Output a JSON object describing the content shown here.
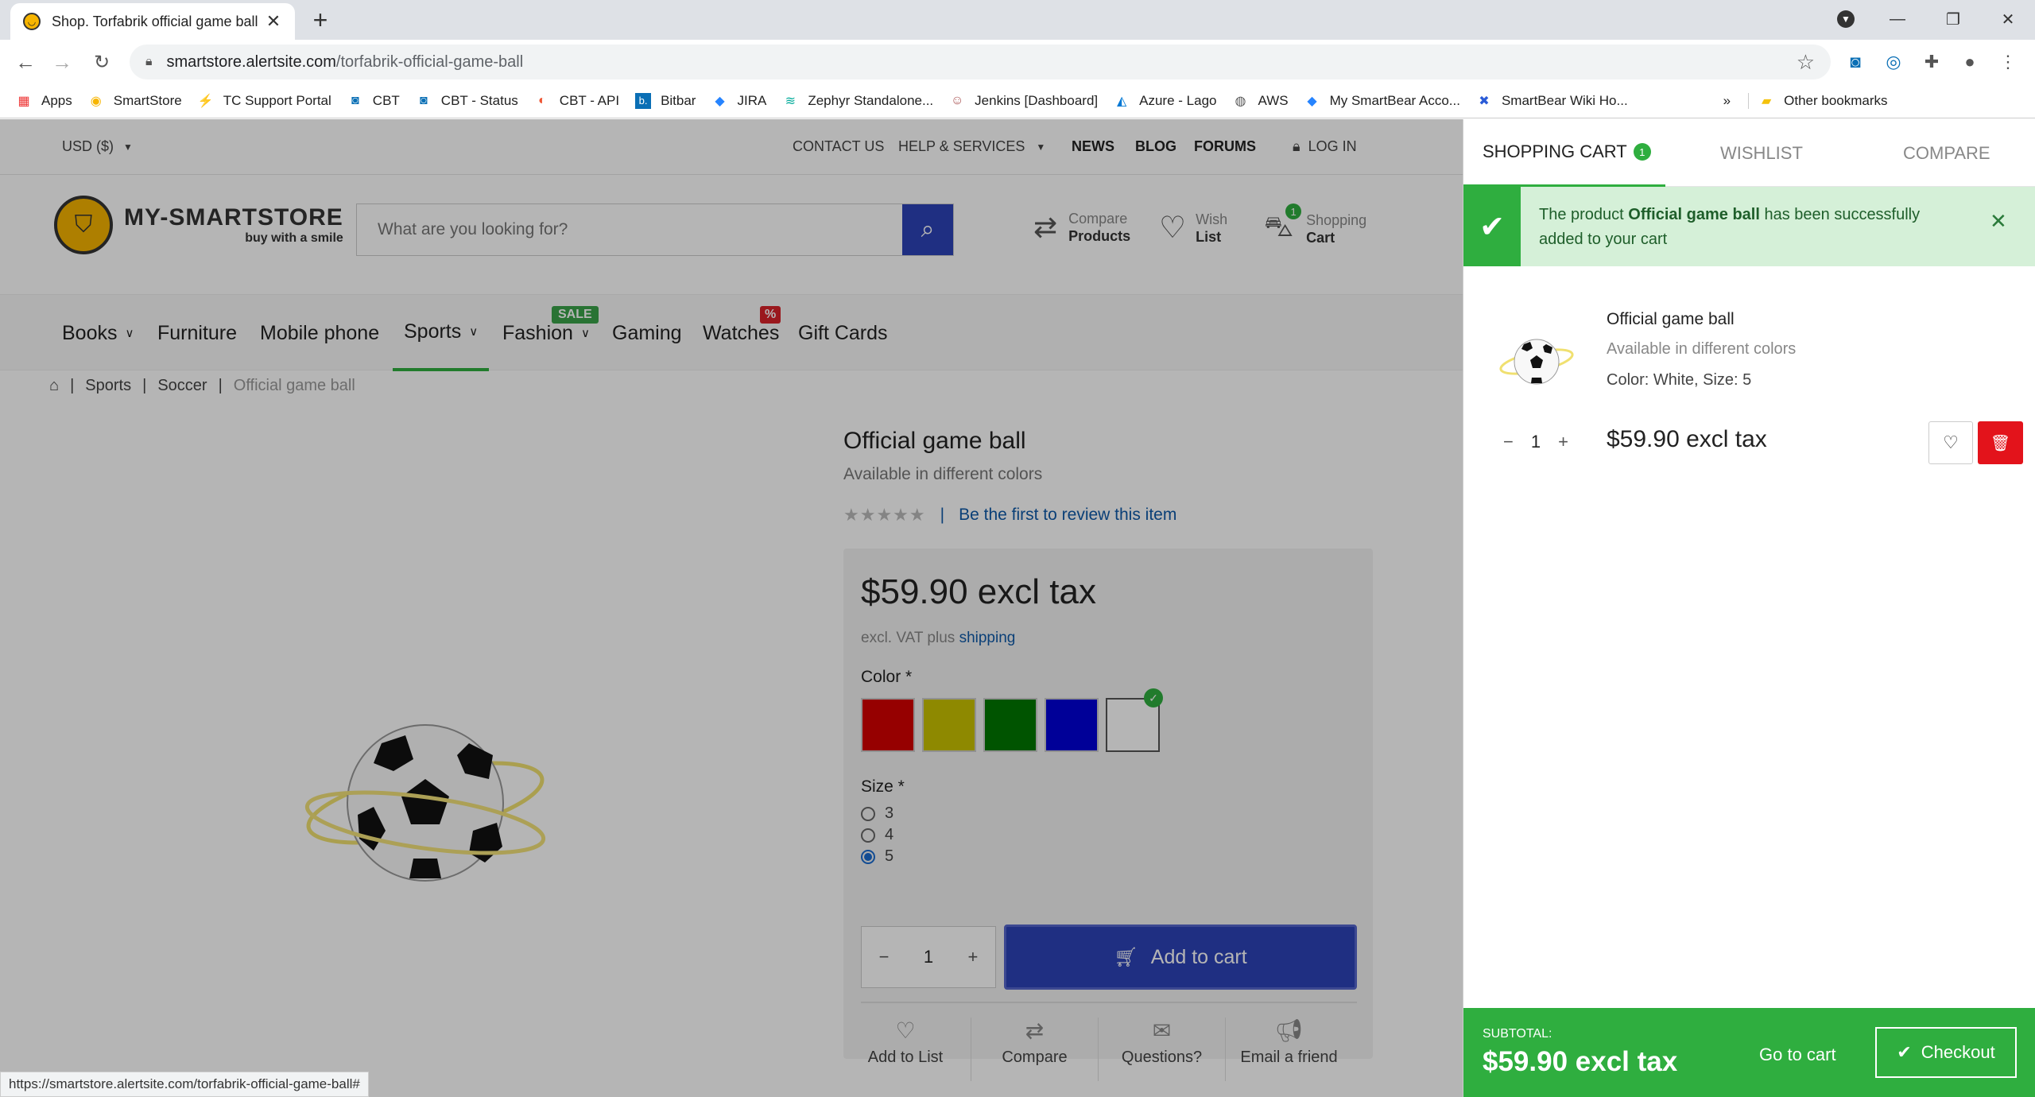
{
  "browser": {
    "tab_title": "Shop. Torfabrik official game ball",
    "url_host": "smartstore.alertsite.com",
    "url_path": "/torfabrik-official-game-ball",
    "bookmarks": [
      "Apps",
      "SmartStore",
      "TC Support Portal",
      "CBT",
      "CBT - Status",
      "CBT - API",
      "Bitbar",
      "JIRA",
      "Zephyr Standalone...",
      "Jenkins [Dashboard]",
      "Azure - Lago",
      "AWS",
      "My SmartBear Acco...",
      "SmartBear Wiki Ho..."
    ],
    "other_bookmarks": "Other bookmarks",
    "more": "»",
    "status_url": "https://smartstore.alertsite.com/torfabrik-official-game-ball#"
  },
  "topbar": {
    "currency": "USD ($)",
    "contact": "CONTACT US",
    "help": "HELP & SERVICES",
    "news": "NEWS",
    "blog": "BLOG",
    "forums": "FORUMS",
    "login": "LOG IN"
  },
  "header": {
    "logo_main": "MY-SMARTSTORE",
    "logo_tag": "buy with a smile",
    "search_placeholder": "What are you looking for?",
    "compare_top": "Compare",
    "compare_bottom": "Products",
    "wish_top": "Wish",
    "wish_bottom": "List",
    "cart_top": "Shopping",
    "cart_bottom": "Cart",
    "cart_count": "1"
  },
  "nav": {
    "items": [
      "Books",
      "Furniture",
      "Mobile phone",
      "Sports",
      "Fashion",
      "Gaming",
      "Watches",
      "Gift Cards"
    ],
    "sale_badge": "SALE",
    "pct_badge": "%"
  },
  "breadcrumb": {
    "sep": "|",
    "items": [
      "Sports",
      "Soccer",
      "Official game ball"
    ]
  },
  "product": {
    "title": "Official game ball",
    "subtitle": "Available in different colors",
    "stars": "★★★★★",
    "review_link": "Be the first to review this item",
    "price": "$59.90 excl tax",
    "vat_text": "excl. VAT plus",
    "shipping": "shipping",
    "color_label": "Color *",
    "colors": [
      "#d40000",
      "#c9c200",
      "#007700",
      "#0000d6",
      "#ffffff"
    ],
    "size_label": "Size *",
    "sizes": [
      "3",
      "4",
      "5"
    ],
    "selected_size": "5",
    "qty": "1",
    "add_to_cart": "Add to cart",
    "actions": [
      "Add to List",
      "Compare",
      "Questions?",
      "Email a friend"
    ]
  },
  "flyout": {
    "tabs": [
      "SHOPPING CART",
      "WISHLIST",
      "COMPARE"
    ],
    "cart_badge": "1",
    "notice_pre": "The product ",
    "notice_bold": "Official game ball",
    "notice_post": " has been successfully added to your cart",
    "item_name": "Official game ball",
    "item_sub": "Available in different colors",
    "item_attr": "Color: White, Size: 5",
    "item_qty": "1",
    "item_price": "$59.90 excl tax",
    "subtotal_label": "SUBTOTAL:",
    "subtotal_value": "$59.90 excl tax",
    "go_to_cart": "Go to cart",
    "checkout": "Checkout"
  },
  "colors": {
    "accent_green": "#2fae3f",
    "brand_blue": "#2d43b8",
    "delete_red": "#e3131b",
    "link_blue": "#0f5aa8"
  }
}
